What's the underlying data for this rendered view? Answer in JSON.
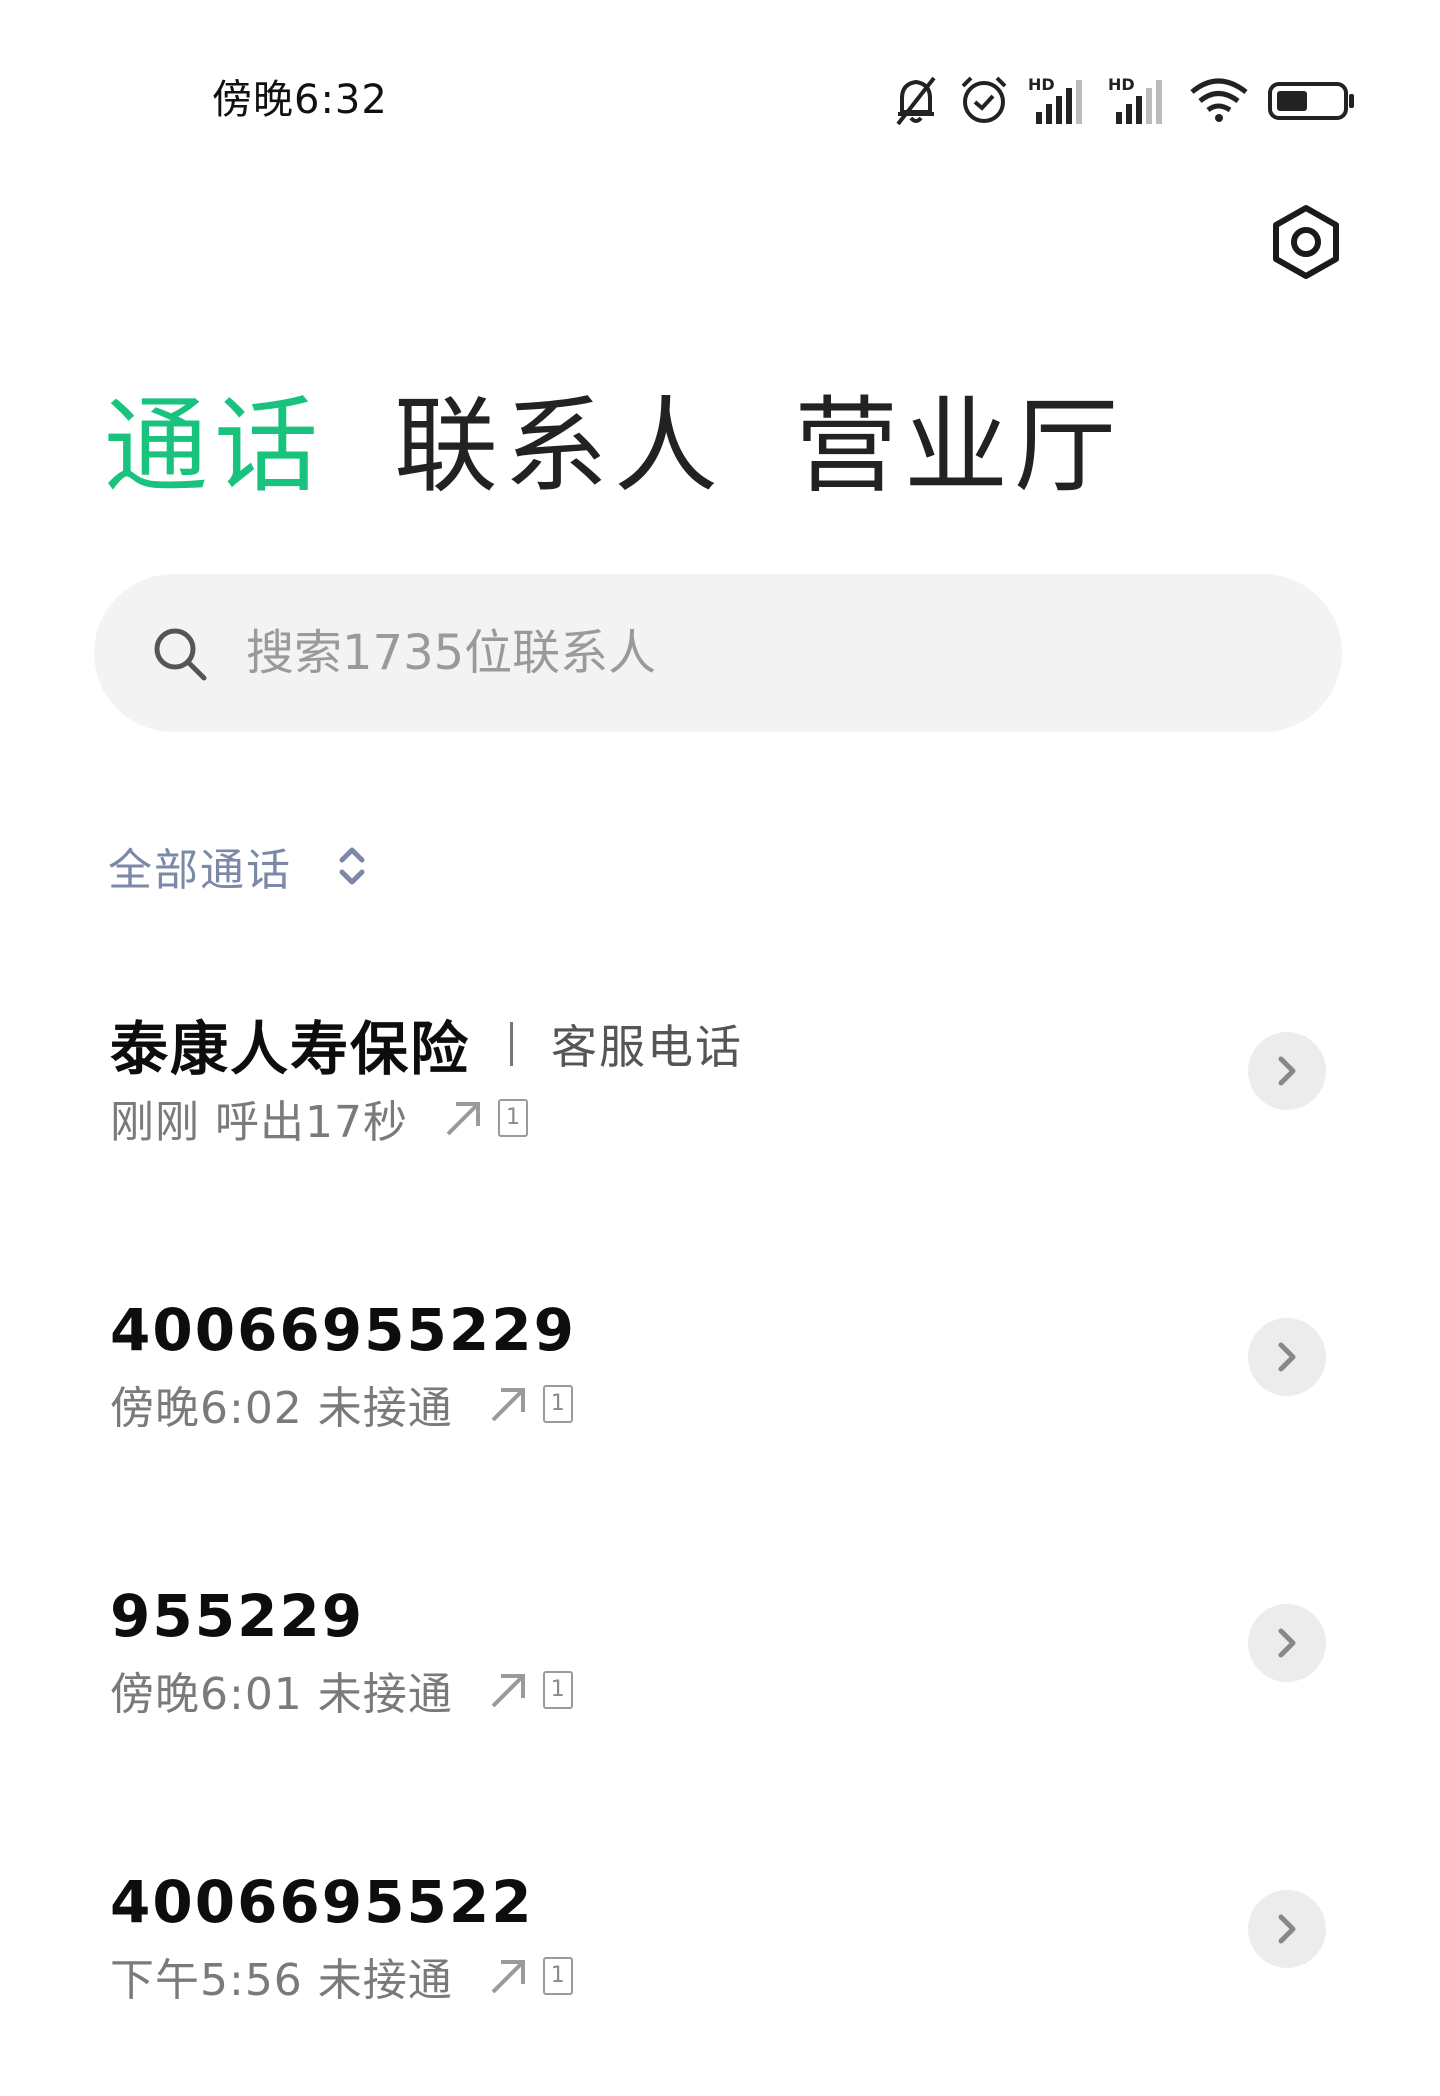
{
  "status_bar": {
    "time": "傍晚6:32",
    "icons": [
      "bell-off-icon",
      "alarm-icon",
      "hd-signal-icon",
      "hd-signal-icon",
      "wifi-icon",
      "battery-icon"
    ],
    "hd_label": "HD"
  },
  "settings": {
    "icon": "settings-icon"
  },
  "tabs": [
    {
      "label": "通话",
      "active": true
    },
    {
      "label": "联系人",
      "active": false
    },
    {
      "label": "营业厅",
      "active": false
    }
  ],
  "search": {
    "placeholder": "搜索1735位联系人",
    "icon": "search-icon"
  },
  "filter": {
    "label": "全部通话",
    "icon": "expand-collapse-icon"
  },
  "calls": [
    {
      "name": "泰康人寿保险",
      "tag": "客服电话",
      "meta": "刚刚 呼出17秒",
      "direction": "outgoing-icon",
      "sim": "1"
    },
    {
      "name": "40066955229",
      "tag": "",
      "meta": "傍晚6:02 未接通",
      "direction": "outgoing-icon",
      "sim": "1"
    },
    {
      "name": "955229",
      "tag": "",
      "meta": "傍晚6:01 未接通",
      "direction": "outgoing-icon",
      "sim": "1"
    },
    {
      "name": "4006695522",
      "tag": "",
      "meta": "下午5:56 未接通",
      "direction": "outgoing-icon",
      "sim": "1"
    }
  ],
  "colors": {
    "accent": "#19c37d",
    "filter": "#7b88a8"
  }
}
